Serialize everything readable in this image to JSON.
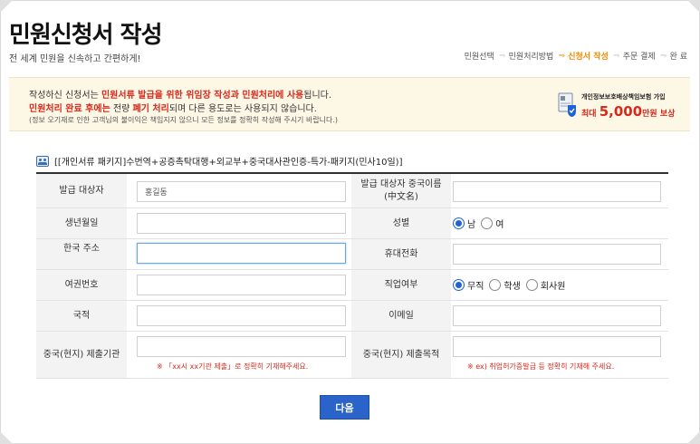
{
  "header": {
    "title": "민원신청서 작성",
    "subtitle": "전 세계 민원을 신속하고 간편하게!"
  },
  "steps": [
    {
      "label": "민원선택",
      "active": false
    },
    {
      "label": "민원처리방법",
      "active": false
    },
    {
      "label": "신청서 작성",
      "active": true
    },
    {
      "label": "주문 결제",
      "active": false
    },
    {
      "label": "완 료",
      "active": false
    }
  ],
  "notice": {
    "line1_pre": "작성하신 신청서는 ",
    "line1_red": "민원서류 발급을 위한 위임장 작성과 민원처리에 사용",
    "line1_post": "됩니다.",
    "line2_red_a": "민원처리 완료 후에는",
    "line2_mid": " 전량 ",
    "line2_red_b": "폐기 처리",
    "line2_post": "되며 다른 용도로는 사용되지 않습니다.",
    "line3": "(정보 오기재로 인한 고객님의 불이익은 책임지지 않으니 모든 정보를 정확히 작성해 주시기 바랍니다.)"
  },
  "insurance": {
    "line1": "개인정보보호배상책임보험 가입",
    "prefix": "최대 ",
    "amount": "5,000",
    "suffix": "만원 보상"
  },
  "package": {
    "title": "[[개인서류 패키지]수번역+공증촉탁대행+외교부+중국대사관인증-특가-패키지(민사10일)]"
  },
  "form": {
    "recipient_label": "발급 대상자",
    "recipient_value": "홍길동",
    "chinese_name_label": "발급 대상자 중국이름\n(中文名)",
    "chinese_name_value": "",
    "birth_label": "생년월일",
    "birth_value": "",
    "gender_label": "성별",
    "gender_options": [
      "남",
      "여"
    ],
    "gender_selected": 0,
    "address_label": "한국 주소",
    "address_value": "",
    "phone_label": "휴대전화",
    "phone_value": "",
    "passport_label": "여권번호",
    "passport_value": "",
    "job_label": "직업여부",
    "job_options": [
      "무직",
      "학생",
      "회사원"
    ],
    "job_selected": 0,
    "nationality_label": "국적",
    "nationality_value": "",
    "email_label": "이메일",
    "email_value": "",
    "agency_label": "중국(현지) 제출기관",
    "agency_value": "",
    "agency_hint": "※ 「xx시 xx기관 제출」로 정확히 기재해주세요.",
    "purpose_label": "중국(현지) 제출목적",
    "purpose_value": "",
    "purpose_hint": "※ ex) 취업허가증발급 등 정확히 기재해 주세요."
  },
  "buttons": {
    "next": "다음"
  },
  "colors": {
    "accent_orange": "#f08a00",
    "alert_red": "#d9291c",
    "button_blue": "#2a63c9",
    "notice_bg": "#fdf7e6"
  }
}
